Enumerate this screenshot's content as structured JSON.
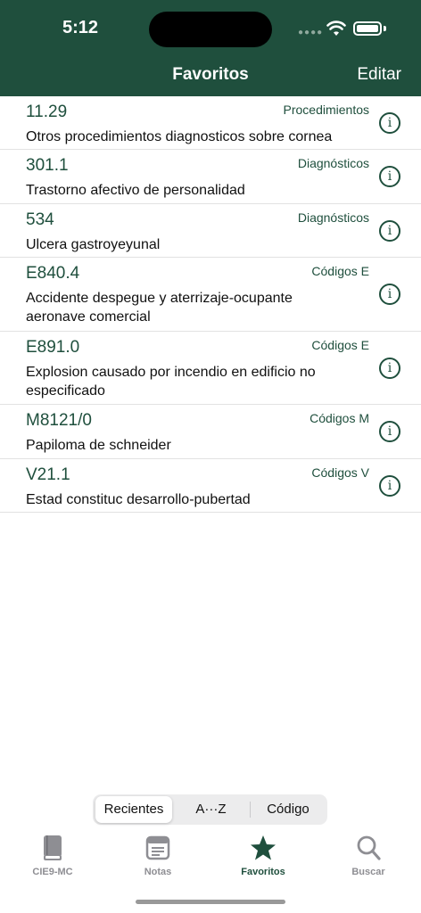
{
  "status": {
    "time": "5:12"
  },
  "nav": {
    "title": "Favoritos",
    "edit": "Editar"
  },
  "items": [
    {
      "code": "11.29",
      "category": "Procedimientos",
      "desc": "Otros procedimientos diagnosticos sobre cornea"
    },
    {
      "code": "301.1",
      "category": "Diagnósticos",
      "desc": "Trastorno afectivo de personalidad"
    },
    {
      "code": "534",
      "category": "Diagnósticos",
      "desc": "Ulcera gastroyeyunal"
    },
    {
      "code": "E840.4",
      "category": "Códigos E",
      "desc": "Accidente despegue y aterrizaje-ocupante aeronave comercial"
    },
    {
      "code": "E891.0",
      "category": "Códigos E",
      "desc": "Explosion causado por incendio en edificio no especificado"
    },
    {
      "code": "M8121/0",
      "category": "Códigos M",
      "desc": "Papiloma de schneider"
    },
    {
      "code": "V21.1",
      "category": "Códigos V",
      "desc": "Estad constituc desarrollo-pubertad"
    }
  ],
  "segments": {
    "recent": "Recientes",
    "az": "A···Z",
    "code": "Código",
    "selected": "Recientes"
  },
  "tabs": [
    {
      "label": "CIE9-MC",
      "icon": "book-icon"
    },
    {
      "label": "Notas",
      "icon": "notes-icon"
    },
    {
      "label": "Favoritos",
      "icon": "star-icon"
    },
    {
      "label": "Buscar",
      "icon": "search-icon"
    }
  ],
  "colors": {
    "brand": "#1f4f3d",
    "inactive": "#8e8e93"
  }
}
